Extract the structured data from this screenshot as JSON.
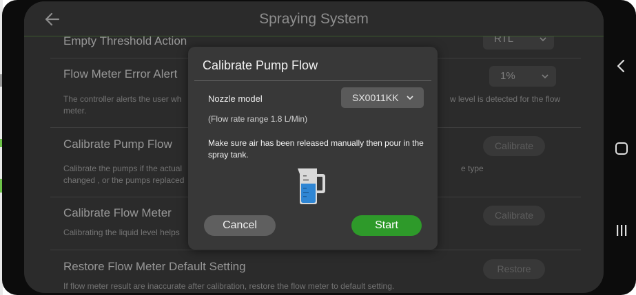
{
  "topbar": {
    "title": "Spraying System"
  },
  "settings": [
    {
      "title": "Empty Threshold Action",
      "control": "RTL"
    },
    {
      "title": "Flow Meter Error Alert",
      "control": "1%",
      "desc_left": "The controller alerts the user wh",
      "desc_right": "w level is detected for the flow",
      "desc_line2": "meter."
    },
    {
      "title": "Calibrate Pump Flow",
      "button": "Calibrate",
      "desc_left": "Calibrate the pumps if the actual",
      "desc_right": "e type",
      "desc_line2": "changed , or the pumps replaced"
    },
    {
      "title": "Calibrate Flow Meter",
      "button": "Calibrate",
      "desc_left": "Calibrating the liquid level helps"
    },
    {
      "title": "Restore Flow Meter Default Setting",
      "button": "Restore",
      "desc": "If flow meter result are inaccurate after calibration, restore the flow meter to default setting."
    }
  ],
  "dialog": {
    "title": "Calibrate Pump Flow",
    "nozzle_label": "Nozzle model",
    "nozzle_value": "SX0011KK",
    "flow_range": "(Flow rate range 1.8 L/Min)",
    "instruction": "Make sure air has been released manually then pour in the spray tank.",
    "cancel_label": "Cancel",
    "start_label": "Start"
  },
  "colors": {
    "accent_green": "#2e9a2a",
    "dialog_bg": "#383838",
    "screen_bg": "#3a3a3a"
  },
  "icons": {
    "back": "arrow-left-icon",
    "jug": "measuring-jug-icon",
    "nav_back": "nav-back-icon",
    "nav_home": "nav-home-icon",
    "nav_recents": "nav-recents-icon"
  }
}
